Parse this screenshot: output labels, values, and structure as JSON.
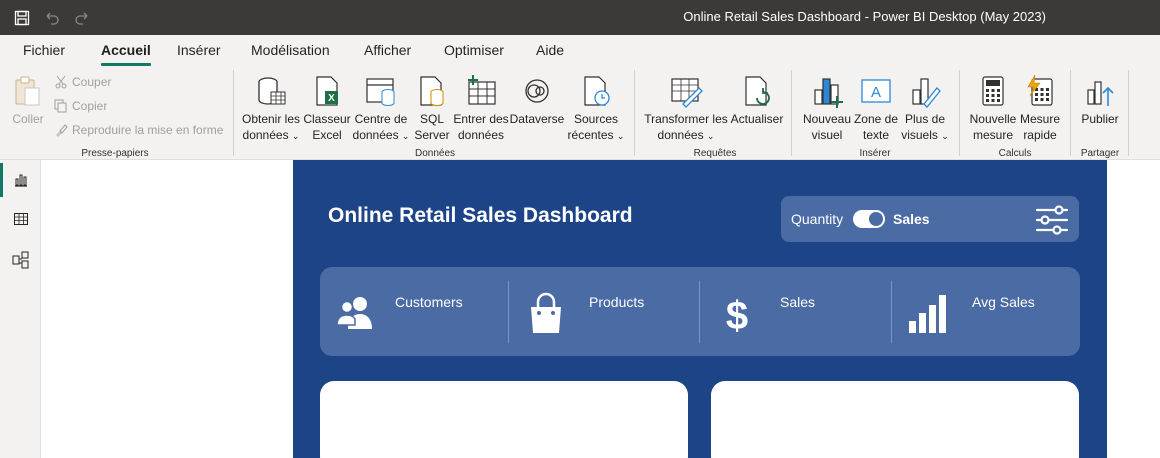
{
  "window": {
    "title": "Online Retail Sales Dashboard - Power BI Desktop (May 2023)"
  },
  "menu": {
    "tabs": [
      {
        "label": "Fichier",
        "active": false
      },
      {
        "label": "Accueil",
        "active": true
      },
      {
        "label": "Insérer",
        "active": false
      },
      {
        "label": "Modélisation",
        "active": false
      },
      {
        "label": "Afficher",
        "active": false
      },
      {
        "label": "Optimiser",
        "active": false
      },
      {
        "label": "Aide",
        "active": false
      }
    ]
  },
  "ribbon": {
    "clipboard": {
      "paste": "Coller",
      "cut": "Couper",
      "copy": "Copier",
      "format_painter": "Reproduire la mise en forme",
      "label": "Presse-papiers"
    },
    "data": {
      "get_data": [
        "Obtenir les",
        "données"
      ],
      "excel": [
        "Classeur",
        "Excel"
      ],
      "data_hub": [
        "Centre de",
        "données"
      ],
      "sql": [
        "SQL",
        "Server"
      ],
      "enter_data": [
        "Entrer des",
        "données"
      ],
      "dataverse": [
        "Dataverse"
      ],
      "recent": [
        "Sources",
        "récentes"
      ],
      "label": "Données"
    },
    "queries": {
      "transform": [
        "Transformer les",
        "données"
      ],
      "refresh": [
        "Actualiser"
      ],
      "label": "Requêtes"
    },
    "insert": {
      "new_visual": [
        "Nouveau",
        "visuel"
      ],
      "text_box": [
        "Zone de",
        "texte"
      ],
      "more_visuals": [
        "Plus de",
        "visuels"
      ],
      "label": "Insérer"
    },
    "calculations": {
      "new_measure": [
        "Nouvelle",
        "mesure"
      ],
      "quick_measure": [
        "Mesure",
        "rapide"
      ],
      "label": "Calculs"
    },
    "share": {
      "publish": [
        "Publier"
      ],
      "label": "Partager"
    }
  },
  "report": {
    "title": "Online Retail Sales Dashboard",
    "toggle": {
      "left": "Quantity",
      "right": "Sales",
      "on": true
    },
    "kpis": [
      {
        "label": "Customers",
        "icon": "customers-icon"
      },
      {
        "label": "Products",
        "icon": "shopping-bag-icon"
      },
      {
        "label": "Sales",
        "icon": "dollar-icon"
      },
      {
        "label": "Avg Sales",
        "icon": "bar-chart-icon"
      }
    ]
  },
  "colors": {
    "accent": "#117865",
    "report_bg": "#1e4488",
    "panel_bg": "#4a6ba4",
    "titlebar": "#3b3a39",
    "ribbon_bg": "#f3f2f1"
  }
}
